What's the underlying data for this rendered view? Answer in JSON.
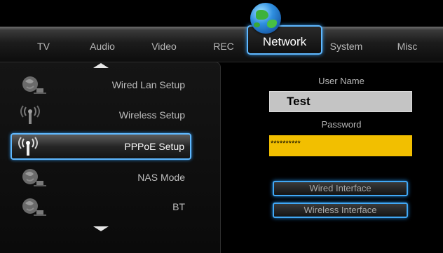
{
  "tabs": [
    {
      "label": "TV"
    },
    {
      "label": "Audio"
    },
    {
      "label": "Video"
    },
    {
      "label": "REC"
    },
    {
      "label": "Network"
    },
    {
      "label": "System"
    },
    {
      "label": "Misc"
    }
  ],
  "active_tab": "Network",
  "menu": {
    "items": [
      {
        "label": "Wired Lan Setup",
        "icon": "globe-network-icon"
      },
      {
        "label": "Wireless Setup",
        "icon": "wireless-antenna-icon"
      },
      {
        "label": "PPPoE Setup",
        "icon": "wireless-antenna-icon"
      },
      {
        "label": "NAS Mode",
        "icon": "globe-network-icon"
      },
      {
        "label": "BT",
        "icon": "globe-network-icon"
      }
    ],
    "selected": "PPPoE Setup"
  },
  "form": {
    "username_label": "User Name",
    "username_value": "Test",
    "password_label": "Password",
    "password_value": "**********",
    "wired_button": "Wired Interface",
    "wireless_button": "Wireless Interface"
  },
  "colors": {
    "highlight_border": "#5fb8ff",
    "password_field": "#f2bf00",
    "username_field": "#c4c4c4"
  }
}
